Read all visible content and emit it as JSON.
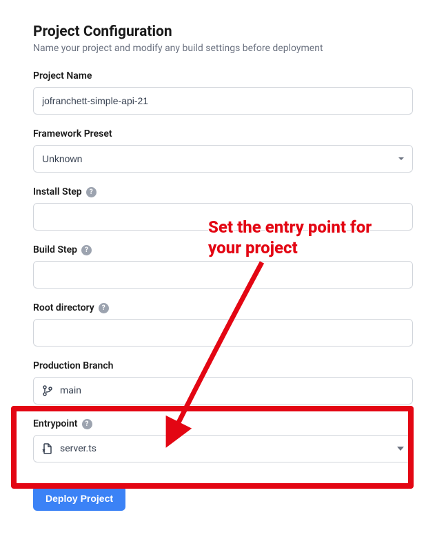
{
  "header": {
    "title": "Project Configuration",
    "subtitle": "Name your project and modify any build settings before deployment"
  },
  "fields": {
    "projectName": {
      "label": "Project Name",
      "value": "jofranchett-simple-api-21"
    },
    "frameworkPreset": {
      "label": "Framework Preset",
      "value": "Unknown"
    },
    "installStep": {
      "label": "Install Step",
      "value": ""
    },
    "buildStep": {
      "label": "Build Step",
      "value": ""
    },
    "rootDirectory": {
      "label": "Root directory",
      "value": ""
    },
    "productionBranch": {
      "label": "Production Branch",
      "value": "main"
    },
    "entrypoint": {
      "label": "Entrypoint",
      "value": "server.ts"
    }
  },
  "deploy": {
    "label": "Deploy Project"
  },
  "annotation": {
    "text": "Set the entry point for your project"
  }
}
